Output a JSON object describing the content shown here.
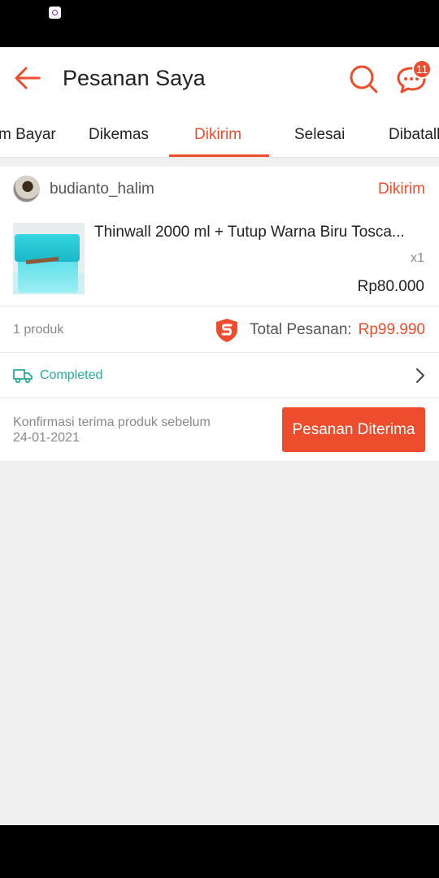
{
  "header": {
    "title": "Pesanan Saya",
    "chat_badge": "11"
  },
  "tabs": [
    {
      "label": "m Bayar",
      "active": false
    },
    {
      "label": "Dikemas",
      "active": false
    },
    {
      "label": "Dikirim",
      "active": true
    },
    {
      "label": "Selesai",
      "active": false
    },
    {
      "label": "Dibatalk",
      "active": false
    }
  ],
  "order": {
    "shop_name": "budianto_halim",
    "status": "Dikirim",
    "product": {
      "name": "Thinwall 2000 ml + Tutup Warna Biru Tosca...",
      "quantity": "x1",
      "price": "Rp80.000"
    },
    "product_count": "1 produk",
    "total_label": "Total Pesanan:",
    "total_value": "Rp99.990",
    "shipping_status": "Completed",
    "confirm_text": "Konfirmasi terima produk sebelum",
    "confirm_date": "24-01-2021",
    "action_button": "Pesanan Diterima"
  },
  "colors": {
    "accent": "#ee4d2d",
    "shipping": "#26aa99",
    "background": "#f0f0f0"
  },
  "icons": [
    "back-arrow-icon",
    "search-icon",
    "chat-icon",
    "shield-icon",
    "truck-icon",
    "chevron-right-icon"
  ]
}
